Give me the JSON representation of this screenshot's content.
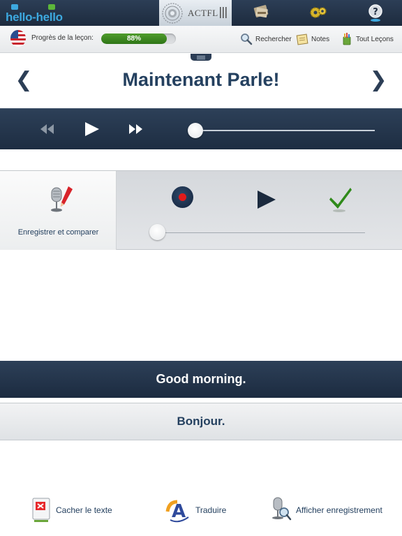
{
  "header": {
    "logo_text": "hello-hello",
    "actfl_text": "ACTFL",
    "icons": [
      "books-icon",
      "gears-icon",
      "help-icon"
    ]
  },
  "progress": {
    "label": "Progrès de la leçon:",
    "value_percent": 88,
    "value_text": "88%",
    "fill_color": "#3f8a22"
  },
  "actions": {
    "search_label": "Rechercher",
    "notes_label": "Notes",
    "all_lessons_label": "Tout Leçons"
  },
  "title": {
    "text": "Maintenant Parle!",
    "prev_icon": "chevron-left-icon",
    "next_icon": "chevron-right-icon"
  },
  "player": {
    "controls": [
      "rewind-icon",
      "play-icon",
      "fast-forward-icon"
    ],
    "position_percent": 0
  },
  "recorder": {
    "label": "Enregistrer et comparer",
    "controls": [
      "record-icon",
      "play-icon",
      "check-icon"
    ],
    "position_percent": 0
  },
  "phrases": {
    "english": "Good morning.",
    "french": "Bonjour."
  },
  "bottom": {
    "hide_text_label": "Cacher le texte",
    "translate_label": "Traduire",
    "show_recording_label": "Afficher enregistrement"
  },
  "colors": {
    "navy": "#24405f",
    "bar_dark": "#1d2d42",
    "accent_green": "#3f8a22",
    "record_red": "#e21b1b"
  }
}
